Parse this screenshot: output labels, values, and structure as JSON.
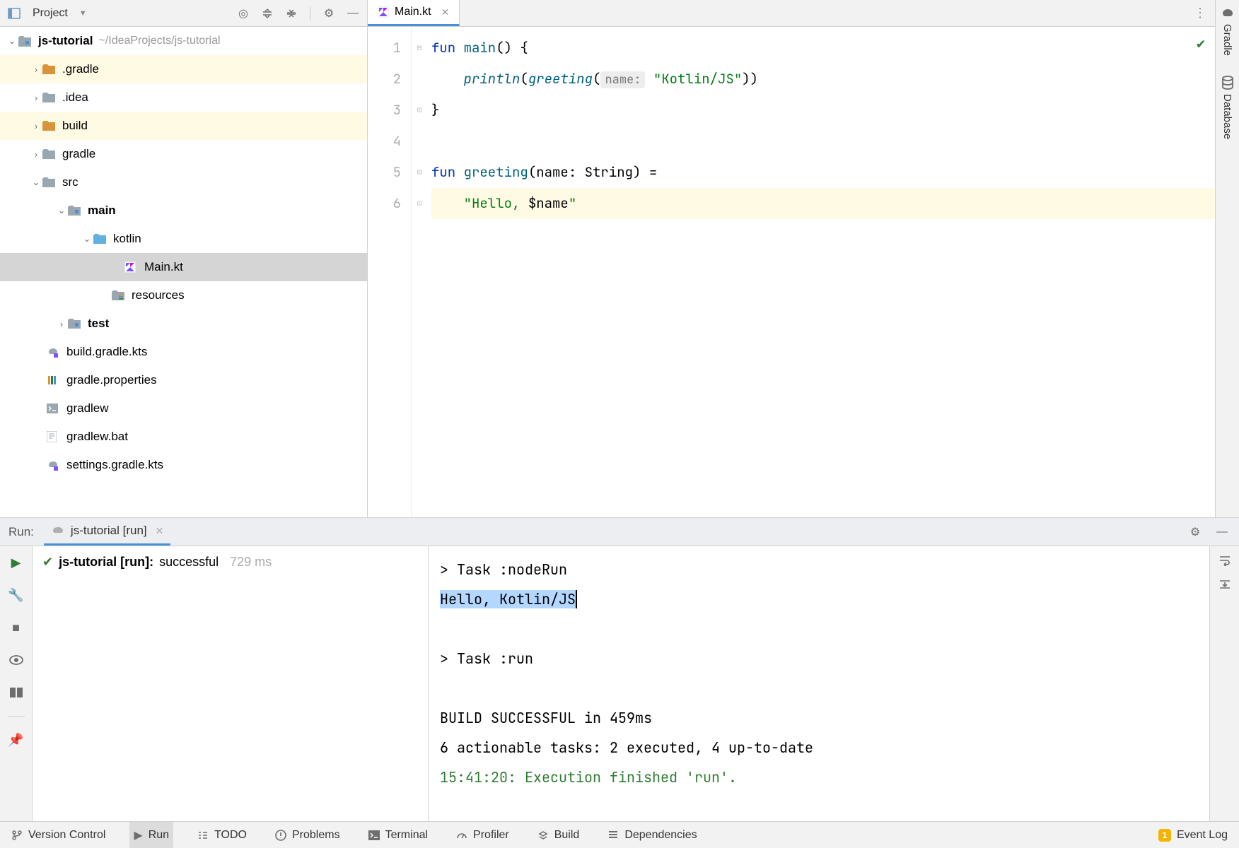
{
  "project_toolbar": {
    "title": "Project"
  },
  "tree": {
    "root": {
      "name": "js-tutorial",
      "path": "~/IdeaProjects/js-tutorial"
    },
    "items": [
      {
        "name": ".gradle"
      },
      {
        "name": ".idea"
      },
      {
        "name": "build"
      },
      {
        "name": "gradle"
      },
      {
        "name": "src"
      },
      {
        "name": "main"
      },
      {
        "name": "kotlin"
      },
      {
        "name": "Main.kt"
      },
      {
        "name": "resources"
      },
      {
        "name": "test"
      },
      {
        "name": "build.gradle.kts"
      },
      {
        "name": "gradle.properties"
      },
      {
        "name": "gradlew"
      },
      {
        "name": "gradlew.bat"
      },
      {
        "name": "settings.gradle.kts"
      }
    ]
  },
  "editor": {
    "tab": "Main.kt",
    "line_count": 6,
    "code": {
      "l1": {
        "kw": "fun ",
        "fn": "main",
        "rest": "() {"
      },
      "l2": {
        "indent": "    ",
        "fn": "println",
        "p1": "(",
        "fni": "greeting",
        "p2": "(",
        "hint": "name:",
        "sp": " ",
        "str": "\"Kotlin/JS\"",
        "p3": "))"
      },
      "l3": {
        "txt": "}"
      },
      "l4": {
        "txt": ""
      },
      "l5": {
        "kw": "fun ",
        "fn": "greeting",
        "p1": "(name: String) ="
      },
      "l6": {
        "indent": "    ",
        "str1": "\"Hello, ",
        "var": "$name",
        "str2": "\""
      }
    }
  },
  "right_gutter": {
    "gradle": "Gradle",
    "database": "Database"
  },
  "run": {
    "label": "Run:",
    "tab": "js-tutorial [run]",
    "result": {
      "name": "js-tutorial [run]:",
      "status": " successful",
      "time": "729 ms"
    },
    "console": {
      "l1": "> Task :nodeRun",
      "l2": "Hello, Kotlin/JS",
      "l3": "> Task :run",
      "l4": "BUILD SUCCESSFUL in 459ms",
      "l5": "6 actionable tasks: 2 executed, 4 up-to-date",
      "l6": "15:41:20: Execution finished 'run'."
    }
  },
  "footer": {
    "version_control": "Version Control",
    "run": "Run",
    "todo": "TODO",
    "problems": "Problems",
    "terminal": "Terminal",
    "profiler": "Profiler",
    "build": "Build",
    "dependencies": "Dependencies",
    "event_log": "Event Log",
    "event_badge": "1"
  }
}
